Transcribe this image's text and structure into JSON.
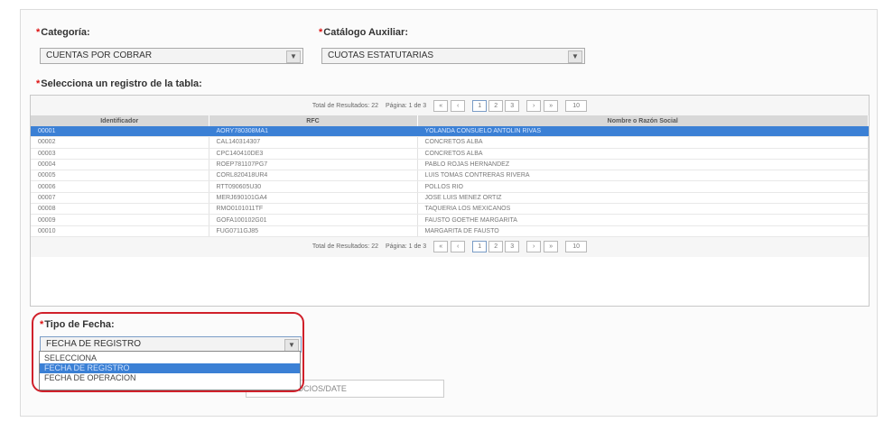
{
  "form": {
    "categoria_label": "Categoría:",
    "categoria_value": "CUENTAS POR COBRAR",
    "catalogo_label": "Catálogo Auxiliar:",
    "catalogo_value": "CUOTAS ESTATUTARIAS",
    "tabla_label": "Selecciona un registro de la tabla:",
    "required_mark": "*"
  },
  "pager": {
    "total_text": "Total de Resultados: 22",
    "page_text": "Página: 1 de 3",
    "first": "«",
    "prev": "‹",
    "pages": [
      "1",
      "2",
      "3"
    ],
    "next": "›",
    "last": "»",
    "page_size": "10"
  },
  "table": {
    "columns": [
      "Identificador",
      "RFC",
      "Nombre o Razón Social"
    ],
    "rows": [
      {
        "id": "00001",
        "rfc": "AORY780308MA1",
        "nombre": "YOLANDA CONSUELO ANTOLIN RIVAS"
      },
      {
        "id": "00002",
        "rfc": "CAL140314307",
        "nombre": "CONCRETOS ALBA"
      },
      {
        "id": "00003",
        "rfc": "CPC140410DE3",
        "nombre": "CONCRETOS ALBA"
      },
      {
        "id": "00004",
        "rfc": "ROEP781107PG7",
        "nombre": "PABLO ROJAS HERNANDEZ"
      },
      {
        "id": "00005",
        "rfc": "CORL820418UR4",
        "nombre": "LUIS TOMAS CONTRERAS RIVERA"
      },
      {
        "id": "00006",
        "rfc": "RTT090605U30",
        "nombre": "POLLOS RIO"
      },
      {
        "id": "00007",
        "rfc": "MERJ690101GA4",
        "nombre": "JOSE LUIS MENEZ ORTIZ"
      },
      {
        "id": "00008",
        "rfc": "RMO0101011TF",
        "nombre": "TAQUERIA LOS MEXICANOS"
      },
      {
        "id": "00009",
        "rfc": "GOFA100102G01",
        "nombre": "FAUSTO GOETHE MARGARITA"
      },
      {
        "id": "00010",
        "rfc": "FUG0711GJ85",
        "nombre": "MARGARITA DE FAUSTO"
      }
    ]
  },
  "fecha": {
    "label": "Tipo de Fecha:",
    "value": "FECHA DE REGISTRO",
    "options": [
      "SELECCIONA",
      "FECHA DE REGISTRO",
      "FECHA DE OPERACION"
    ],
    "selected_index": 1,
    "ghost_value": "SOCIOS/DATE"
  },
  "colors": {
    "selection": "#3b80d5",
    "highlight_border": "#d0202a"
  }
}
